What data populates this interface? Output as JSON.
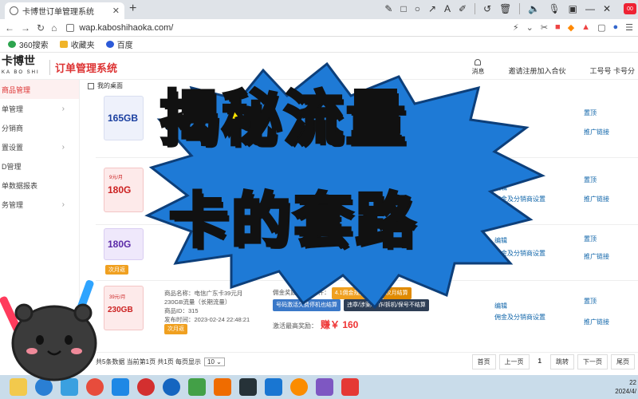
{
  "browser": {
    "tab_title": "卡博世订单管理系统",
    "url": "wap.kaboshihaoka.com/",
    "bookmarks": [
      {
        "label": "360搜索",
        "icon": "search-icon"
      },
      {
        "label": "收藏夹",
        "icon": "folder-icon"
      },
      {
        "label": "百度",
        "icon": "paw-icon"
      }
    ],
    "notif_badge": "00"
  },
  "app": {
    "logo": "卡博世",
    "logo_sub": "KA BO SHI",
    "name": "订单管理系统",
    "header_links": [
      "消息",
      "邀请注册加入合伙",
      "工号号 卡号分"
    ]
  },
  "sidebar": {
    "items": [
      {
        "label": "商品管理",
        "active": true
      },
      {
        "label": "单管理",
        "chevron": true
      },
      {
        "label": "分销商"
      },
      {
        "label": "置设置",
        "chevron": true
      },
      {
        "label": "D管理"
      },
      {
        "label": "单数据报表"
      },
      {
        "label": "务管理",
        "chevron": true
      }
    ]
  },
  "main": {
    "breadcrumb": "我的桌面",
    "rows": [
      {
        "thumb_label": "165GB",
        "actions": [],
        "pin": "置顶",
        "promo": "推广链接"
      },
      {
        "thumb_label": "180G",
        "thumb_price": "9元/月",
        "actions": [
          "编辑",
          "佣金及分销商设置"
        ],
        "pin": "置顶",
        "promo": "推广链接"
      },
      {
        "thumb_label": "180G",
        "actions": [
          "编辑",
          "佣金及分销商设置"
        ],
        "pin": "置顶",
        "promo": "推广链接",
        "tag": "次月返"
      },
      {
        "thumb_label": "230GB",
        "thumb_price": "39元/月",
        "product_name": "商品名称：电信广东卡39元月",
        "traffic": "230GB流量（长期流量）",
        "product_id": "商品ID：315",
        "publish_time": "发布时间：2023-02-24 22:48:21",
        "settle_tag": "次月返",
        "commission_label": "佣金奖励/规则/条件：",
        "tags": [
          {
            "text": "4.1佣金规则调整",
            "style": "y"
          },
          {
            "text": "次月结算",
            "style": "g"
          },
          {
            "text": "号码激活欠费停机也结算",
            "style": "b"
          },
          {
            "text": "违章/涉案/涉诈/拆机/保号不结算",
            "style": "d"
          }
        ],
        "price_label": "激活最高奖励：",
        "price_value": "赚￥ 160",
        "actions": [
          "编辑",
          "佣金及分销商设置"
        ],
        "pin": "置顶",
        "promo": "推广链接"
      }
    ],
    "pager": {
      "summary": "共5条数据 当前第1页 共1页 每页显示",
      "page_size": "10",
      "buttons": [
        "首页",
        "上一页",
        "1",
        "跳转",
        "下一页",
        "尾页"
      ]
    }
  },
  "overlay": {
    "line1": "揭秘流量",
    "line2": "卡的套路"
  },
  "taskbar": {
    "clock_time": "22",
    "clock_date": "2024/4/"
  },
  "colors": {
    "brand_red": "#d33333",
    "overlay_yellow": "#ffe600",
    "burst_blue": "#1e7ad6",
    "taskbar": "#c9dcea"
  }
}
